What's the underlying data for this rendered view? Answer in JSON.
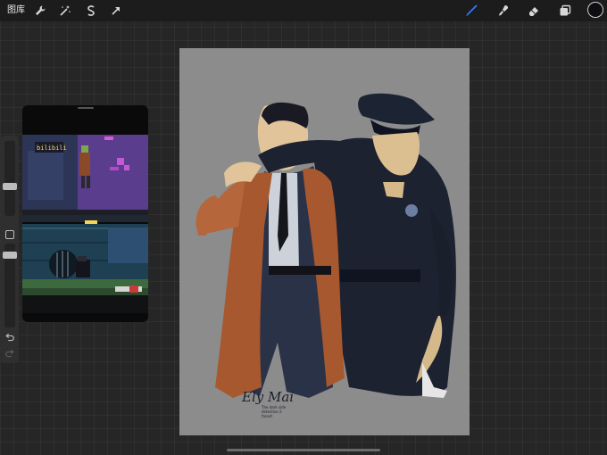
{
  "topbar": {
    "gallery_label": "图库",
    "left_tools": [
      {
        "name": "wrench-icon"
      },
      {
        "name": "magic-wand-icon"
      },
      {
        "name": "selection-icon"
      },
      {
        "name": "transform-arrow-icon"
      }
    ],
    "right_tools": [
      {
        "name": "brush-icon",
        "active": true
      },
      {
        "name": "smudge-icon"
      },
      {
        "name": "eraser-icon"
      },
      {
        "name": "layers-icon"
      }
    ],
    "active_color": "#0d0d12",
    "accent_color": "#2f7bff"
  },
  "sidebar": {
    "brush_size_level": 0.58,
    "opacity_level": 0.45
  },
  "reference": {
    "sign_text": "bilibili"
  },
  "canvas": {
    "background_color": "#8c8c8c",
    "signature": {
      "main": "Ely Mai",
      "line1": "The dark side",
      "line2": "detective 2",
      "line3": "fanart"
    }
  }
}
